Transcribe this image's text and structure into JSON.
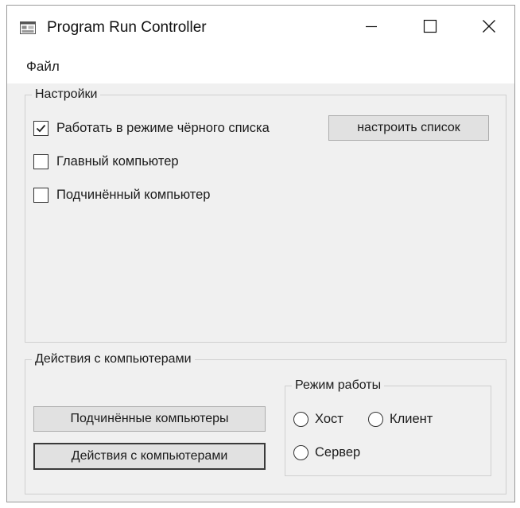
{
  "window": {
    "title": "Program Run Controller",
    "app_icon": "app-window-icon",
    "controls": {
      "minimize_icon": "minimize-icon",
      "maximize_icon": "maximize-icon",
      "close_icon": "close-icon"
    }
  },
  "menu": {
    "items": [
      {
        "label": "Файл"
      }
    ]
  },
  "settings": {
    "title": "Настройки",
    "blacklist_mode": {
      "label": "Работать в режиме чёрного списка",
      "checked": true
    },
    "configure_list_label": "настроить список",
    "main_computer": {
      "label": "Главный компьютер",
      "checked": false
    },
    "slave_computer": {
      "label": "Подчинённый компьютер",
      "checked": false
    }
  },
  "actions": {
    "title": "Действия с компьютерами",
    "slave_computers_label": "Подчинённые компьютеры",
    "computer_actions_label": "Действия с компьютерами",
    "mode": {
      "title": "Режим работы",
      "options": [
        {
          "label": "Хост",
          "selected": false
        },
        {
          "label": "Клиент",
          "selected": false
        },
        {
          "label": "Сервер",
          "selected": false
        }
      ]
    }
  },
  "colors": {
    "window_bg": "#f0f0f0",
    "titlebar_bg": "#ffffff",
    "button_bg": "#e1e1e1",
    "group_border": "#cfcfcf"
  }
}
